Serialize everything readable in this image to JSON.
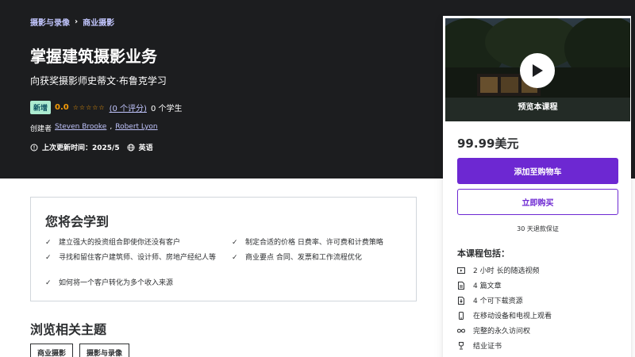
{
  "breadcrumb": {
    "items": [
      "摄影与录像",
      "商业摄影"
    ]
  },
  "course": {
    "title": "掌握建筑摄影业务",
    "subtitle": "向获奖摄影师史蒂文·布鲁克学习",
    "badge": "新增",
    "rating": "0.0",
    "rating_count": "(0 个评分)",
    "students": "0 个学生",
    "created_by_label": "创建者",
    "instructors": [
      "Steven Brooke",
      "Robert Lyon"
    ],
    "last_updated": "上次更新时间：2025/5",
    "language": "英语"
  },
  "learn": {
    "title": "您将会学到",
    "items": [
      "建立强大的投资组合即使你还没有客户",
      "制定合适的价格 日费率、许可费和计费策略",
      "寻找和留住客户建筑师、设计师、房地产经纪人等",
      "商业要点 合同、发票和工作流程优化",
      "如何将一个客户转化为多个收入来源"
    ]
  },
  "related": {
    "title": "浏览相关主题",
    "tags": [
      "商业摄影",
      "摄影与录像"
    ]
  },
  "sidebar": {
    "preview_label": "预览本课程",
    "price": "99.99美元",
    "add_to_cart": "添加至购物车",
    "buy_now": "立即购买",
    "guarantee": "30 天退款保证",
    "includes_title": "本课程包括：",
    "includes": [
      {
        "icon": "video-icon",
        "text": "2 小时 长的随选视频"
      },
      {
        "icon": "article-icon",
        "text": "4 篇文章"
      },
      {
        "icon": "download-icon",
        "text": "4 个可下载资源"
      },
      {
        "icon": "mobile-icon",
        "text": "在移动设备和电视上观看"
      },
      {
        "icon": "infinity-icon",
        "text": "完整的永久访问权"
      },
      {
        "icon": "trophy-icon",
        "text": "结业证书"
      }
    ]
  },
  "colors": {
    "hero_bg": "#1c1d1f",
    "accent": "#6d28d2",
    "link": "#c0c4fc",
    "rating": "#f69c08",
    "badge_bg": "#acebd0"
  }
}
